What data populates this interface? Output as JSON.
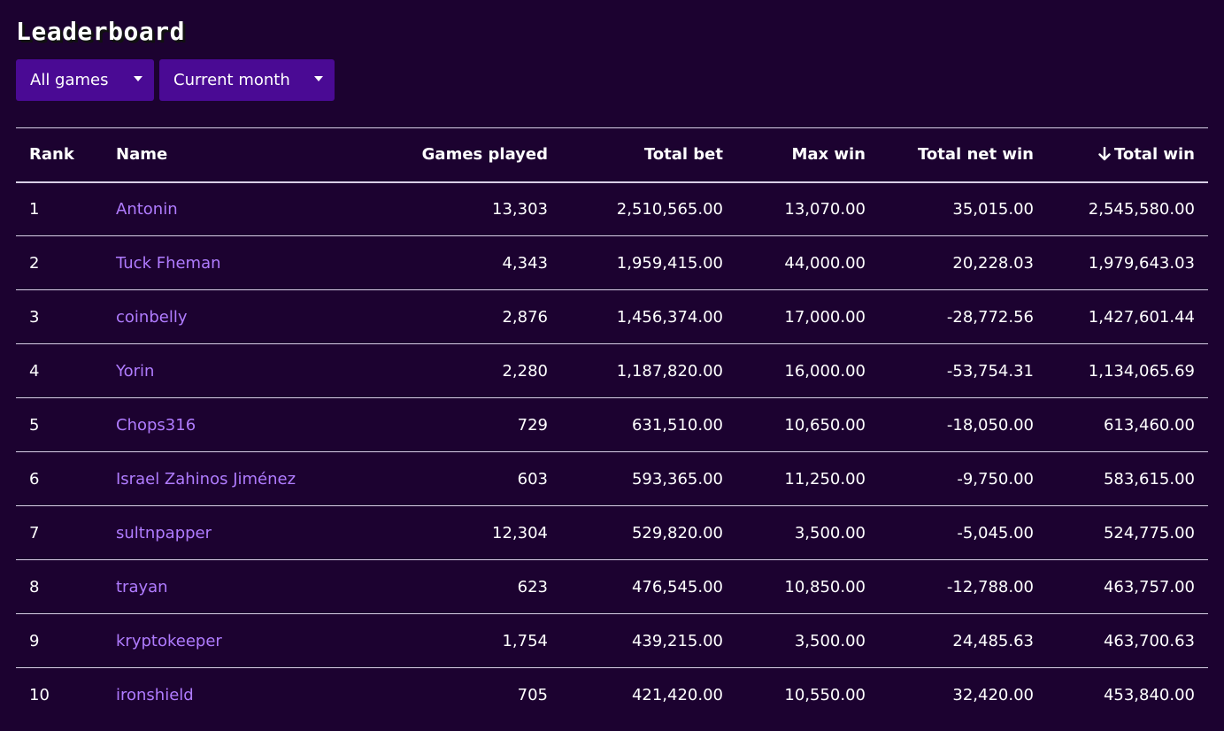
{
  "page": {
    "title": "Leaderboard"
  },
  "filters": {
    "game_select": {
      "value": "All games"
    },
    "period_select": {
      "value": "Current month"
    }
  },
  "table": {
    "columns": [
      "Rank",
      "Name",
      "Games played",
      "Total bet",
      "Max win",
      "Total net win",
      "Total win"
    ],
    "sort_column": "Total win",
    "sort_direction": "descending",
    "rows": [
      {
        "rank": "1",
        "name": "Antonin",
        "games_played": "13,303",
        "total_bet": "2,510,565.00",
        "max_win": "13,070.00",
        "total_net_win": "35,015.00",
        "total_win": "2,545,580.00"
      },
      {
        "rank": "2",
        "name": "Tuck Fheman",
        "games_played": "4,343",
        "total_bet": "1,959,415.00",
        "max_win": "44,000.00",
        "total_net_win": "20,228.03",
        "total_win": "1,979,643.03"
      },
      {
        "rank": "3",
        "name": "coinbelly",
        "games_played": "2,876",
        "total_bet": "1,456,374.00",
        "max_win": "17,000.00",
        "total_net_win": "-28,772.56",
        "total_win": "1,427,601.44"
      },
      {
        "rank": "4",
        "name": "Yorin",
        "games_played": "2,280",
        "total_bet": "1,187,820.00",
        "max_win": "16,000.00",
        "total_net_win": "-53,754.31",
        "total_win": "1,134,065.69"
      },
      {
        "rank": "5",
        "name": "Chops316",
        "games_played": "729",
        "total_bet": "631,510.00",
        "max_win": "10,650.00",
        "total_net_win": "-18,050.00",
        "total_win": "613,460.00"
      },
      {
        "rank": "6",
        "name": "Israel Zahinos Jiménez",
        "games_played": "603",
        "total_bet": "593,365.00",
        "max_win": "11,250.00",
        "total_net_win": "-9,750.00",
        "total_win": "583,615.00"
      },
      {
        "rank": "7",
        "name": "sultnpapper",
        "games_played": "12,304",
        "total_bet": "529,820.00",
        "max_win": "3,500.00",
        "total_net_win": "-5,045.00",
        "total_win": "524,775.00"
      },
      {
        "rank": "8",
        "name": "trayan",
        "games_played": "623",
        "total_bet": "476,545.00",
        "max_win": "10,850.00",
        "total_net_win": "-12,788.00",
        "total_win": "463,757.00"
      },
      {
        "rank": "9",
        "name": "kryptokeeper",
        "games_played": "1,754",
        "total_bet": "439,215.00",
        "max_win": "3,500.00",
        "total_net_win": "24,485.63",
        "total_win": "463,700.63"
      },
      {
        "rank": "10",
        "name": "ironshield",
        "games_played": "705",
        "total_bet": "421,420.00",
        "max_win": "10,550.00",
        "total_net_win": "32,420.00",
        "total_win": "453,840.00"
      }
    ]
  },
  "icons": {
    "sort": "arrow-down-icon",
    "dropdown": "caret-down-icon"
  },
  "colors": {
    "background": "#1c0230",
    "select_background": "#4a0a94",
    "link": "#b07cff",
    "divider": "#d8cfe6"
  }
}
